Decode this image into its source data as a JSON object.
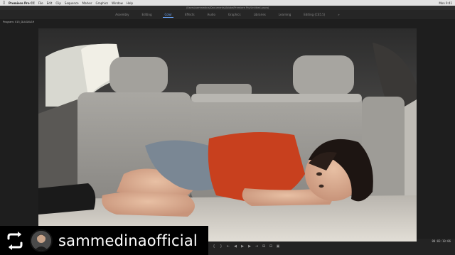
{
  "menubar": {
    "apple_icon": "apple-logo-icon",
    "app_name": "Premiere Pro CC",
    "items": [
      "File",
      "Edit",
      "Clip",
      "Sequence",
      "Marker",
      "Graphics",
      "Window",
      "Help"
    ],
    "clock": "Mon 9:41"
  },
  "window": {
    "title": "/Users/sammedina/Documents/Adobe/Premiere Pro/Untitled.prproj",
    "workspaces": [
      {
        "label": "Assembly",
        "active": false
      },
      {
        "label": "Editing",
        "active": false
      },
      {
        "label": "Color",
        "active": true
      },
      {
        "label": "Effects",
        "active": false
      },
      {
        "label": "Audio",
        "active": false
      },
      {
        "label": "Graphics",
        "active": false
      },
      {
        "label": "Libraries",
        "active": false
      },
      {
        "label": "Learning",
        "active": false
      },
      {
        "label": "Editing (CS5.5)",
        "active": false
      }
    ]
  },
  "monitor": {
    "header": "Program: 015_DLUGAV19"
  },
  "playback": {
    "timecode": "00:03:10:06",
    "controls": [
      "mark-in-icon",
      "mark-out-icon",
      "go-to-in-icon",
      "step-back-icon",
      "play-icon",
      "step-forward-icon",
      "go-to-out-icon",
      "insert-icon",
      "overwrite-icon",
      "export-frame-icon"
    ]
  },
  "repost": {
    "icon": "repost-icon",
    "username": "sammedinaofficial"
  },
  "colors": {
    "ui_bg": "#232323",
    "accent": "#6aa8ff",
    "shirt": "#c8401e"
  }
}
